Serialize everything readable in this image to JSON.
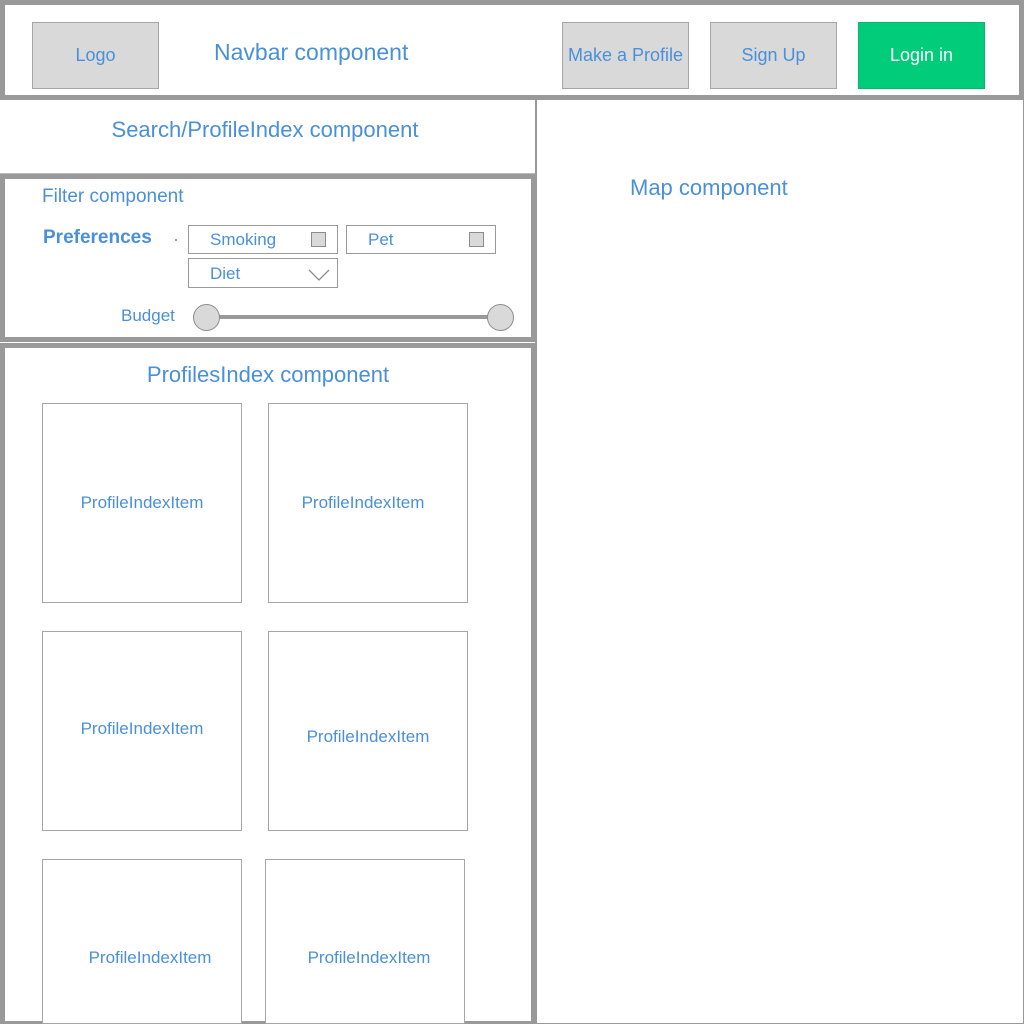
{
  "navbar": {
    "logo_label": "Logo",
    "title": "Navbar component",
    "make_profile_label": "Make a Profile",
    "sign_up_label": "Sign Up",
    "login_label": "Login in"
  },
  "search": {
    "title": "Search/ProfileIndex component"
  },
  "map": {
    "title": "Map component"
  },
  "filter": {
    "title": "Filter component",
    "preferences_label": "Preferences",
    "smoking_label": "Smoking",
    "pet_label": "Pet",
    "diet_label": "Diet",
    "budget_label": "Budget"
  },
  "profiles": {
    "title": "ProfilesIndex component",
    "items": [
      "ProfileIndexItem",
      "ProfileIndexItem",
      "ProfileIndexItem",
      "ProfileIndexItem",
      "ProfileIndexItem",
      "ProfileIndexItem"
    ]
  },
  "colors": {
    "label_blue": "#4a90d9",
    "border_gray": "#999999",
    "login_green": "#00cc7a",
    "box_gray": "#d9d9d9"
  }
}
